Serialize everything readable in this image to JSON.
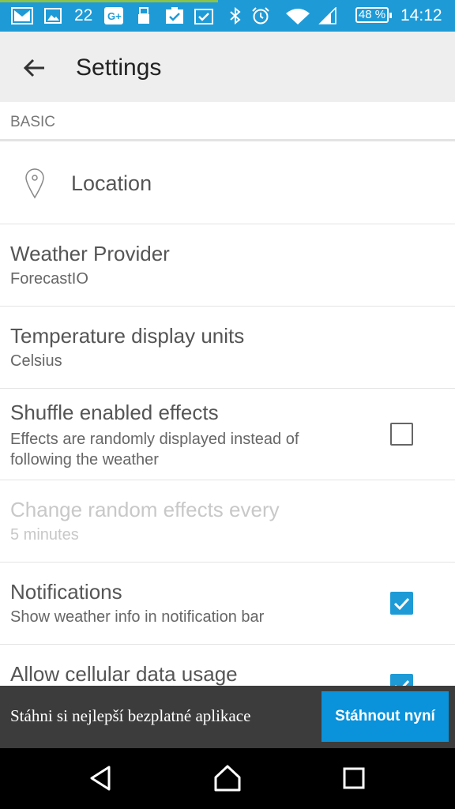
{
  "status_bar": {
    "notification_count": "22",
    "battery": "48 %",
    "time": "14:12",
    "icons": [
      "gmail-icon",
      "gallery-icon",
      "google-plus-icon",
      "usb-icon",
      "task-done-icon",
      "task-done-icon",
      "bluetooth-icon",
      "alarm-icon",
      "wifi-icon",
      "cell-signal-icon",
      "battery-icon"
    ]
  },
  "app_bar": {
    "title": "Settings",
    "back_icon": "arrow-left-icon"
  },
  "preferences": {
    "section_basic": "BASIC",
    "location": {
      "title": "Location",
      "icon": "location-pin-icon"
    },
    "weather_provider": {
      "title": "Weather Provider",
      "summary": "ForecastIO"
    },
    "temperature_units": {
      "title": "Temperature display units",
      "summary": "Celsius"
    },
    "shuffle_effects": {
      "title": "Shuffle enabled effects",
      "summary_line1": "Effects are randomly displayed instead of",
      "summary_line2": "following the weather",
      "checked": false
    },
    "random_interval": {
      "title": "Change random effects every",
      "summary": "5 minutes",
      "enabled": false
    },
    "notifications": {
      "title": "Notifications",
      "summary": "Show weather info in notification bar",
      "checked": true
    },
    "cellular_data": {
      "title": "Allow cellular data usage",
      "checked": true
    }
  },
  "ad_banner": {
    "text": "Stáhni si nejlepší bezplatné aplikace",
    "button_label": "Stáhnout nyní"
  },
  "colors": {
    "accent": "#1e9bd7",
    "banner_bg": "#3c3c3c",
    "banner_button": "#0a92da"
  },
  "nav_bar": {
    "icons": [
      "back-triangle-icon",
      "home-icon",
      "recents-icon"
    ]
  }
}
